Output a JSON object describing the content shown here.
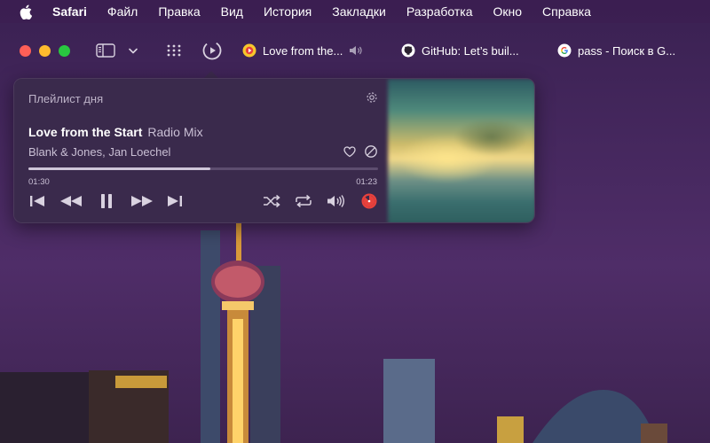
{
  "menubar": {
    "app_name": "Safari",
    "items": [
      "Файл",
      "Правка",
      "Вид",
      "История",
      "Закладки",
      "Разработка",
      "Окно",
      "Справка"
    ]
  },
  "toolbar": {
    "tabs": [
      {
        "title": "Love from the...",
        "favicon": "music-app-icon"
      },
      {
        "title": "GitHub: Let’s buil...",
        "favicon": "github-icon"
      },
      {
        "title": "pass - Поиск в G...",
        "favicon": "google-icon"
      }
    ]
  },
  "player": {
    "playlist_title": "Плейлист дня",
    "track_title": "Love from the Start",
    "track_mix": "Radio Mix",
    "artist": "Blank & Jones, Jan Loechel",
    "time_elapsed": "01:30",
    "time_remaining": "01:23",
    "progress_fraction": 0.52
  },
  "colors": {
    "accent": "#e8413c",
    "close": "#fe5f57",
    "minimize": "#febb2e",
    "zoom": "#29c840"
  }
}
